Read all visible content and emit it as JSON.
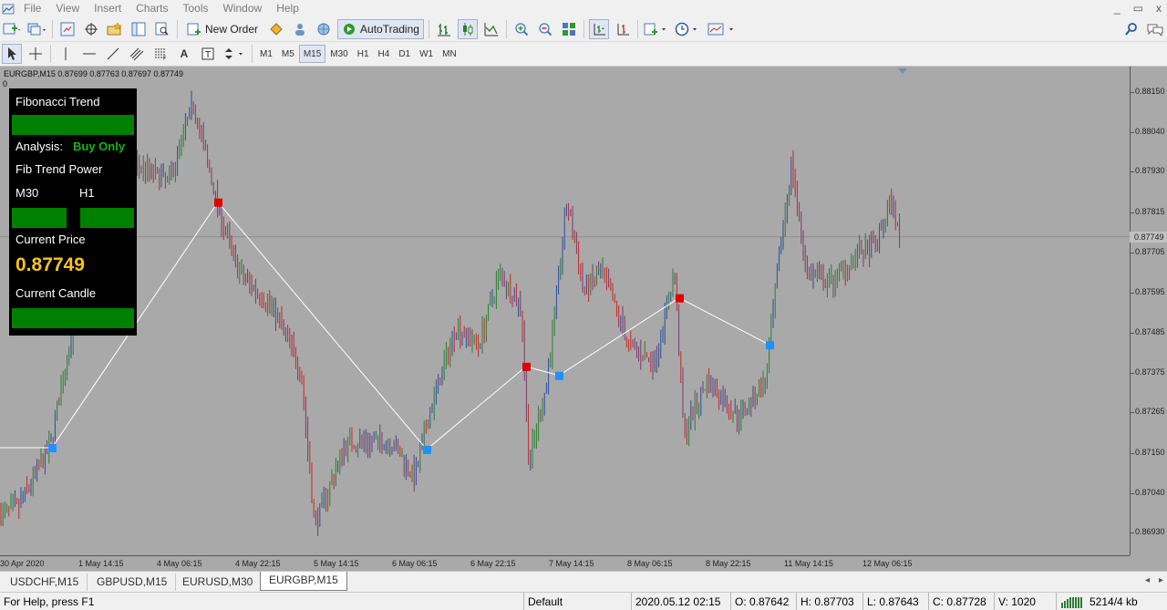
{
  "menu": [
    "File",
    "View",
    "Insert",
    "Charts",
    "Tools",
    "Window",
    "Help"
  ],
  "window_controls": [
    "_",
    "▭",
    "x"
  ],
  "toolbar": {
    "new_order_label": "New Order",
    "autotrading_label": "AutoTrading"
  },
  "timeframes": [
    "M1",
    "M5",
    "M15",
    "M30",
    "H1",
    "H4",
    "D1",
    "W1",
    "MN"
  ],
  "active_timeframe": "M15",
  "chart": {
    "header": "EURGBP,M15  0.87699 0.87763 0.87697 0.87749",
    "header_zero": "0",
    "current_price": "0.87749",
    "price_ticks": [
      "0.88150",
      "0.88040",
      "0.87930",
      "0.87815",
      "0.87705",
      "0.87595",
      "0.87485",
      "0.87375",
      "0.87265",
      "0.87150",
      "0.87040",
      "0.86930"
    ],
    "time_ticks": [
      "30 Apr 2020",
      "1 May 14:15",
      "4 May 06:15",
      "4 May 22:15",
      "5 May 14:15",
      "6 May 06:15",
      "6 May 22:15",
      "7 May 14:15",
      "8 May 06:15",
      "8 May 22:15",
      "11 May 14:15",
      "12 May 06:15"
    ],
    "background_color": "#a9a9a9",
    "bull_color": "#2e7d32",
    "bear_color": "#c62828",
    "zigzag_color": "#ffffff",
    "high_marker_color": "#e00000",
    "low_marker_color": "#1e90ff"
  },
  "fib_panel": {
    "title": "Fibonacci Trend",
    "analysis_label": "Analysis:",
    "analysis_value": "Buy Only",
    "trend_power_label": "Fib Trend Power",
    "m30_label": "M30",
    "h1_label": "H1",
    "current_price_label": "Current Price",
    "current_price_value": "0.87749",
    "current_candle_label": "Current Candle",
    "bar_color": "#008000"
  },
  "tabs": [
    "USDCHF,M15",
    "GBPUSD,M15",
    "EURUSD,M30",
    "EURGBP,M15"
  ],
  "active_tab": "EURGBP,M15",
  "status": {
    "help": "For Help, press F1",
    "profile": "Default",
    "datetime": "2020.05.12 02:15",
    "open": "O: 0.87642",
    "high": "H: 0.87703",
    "low": "L: 0.87643",
    "close": "C: 0.87728",
    "volume": "V: 1020",
    "traffic": "5214/4 kb"
  }
}
